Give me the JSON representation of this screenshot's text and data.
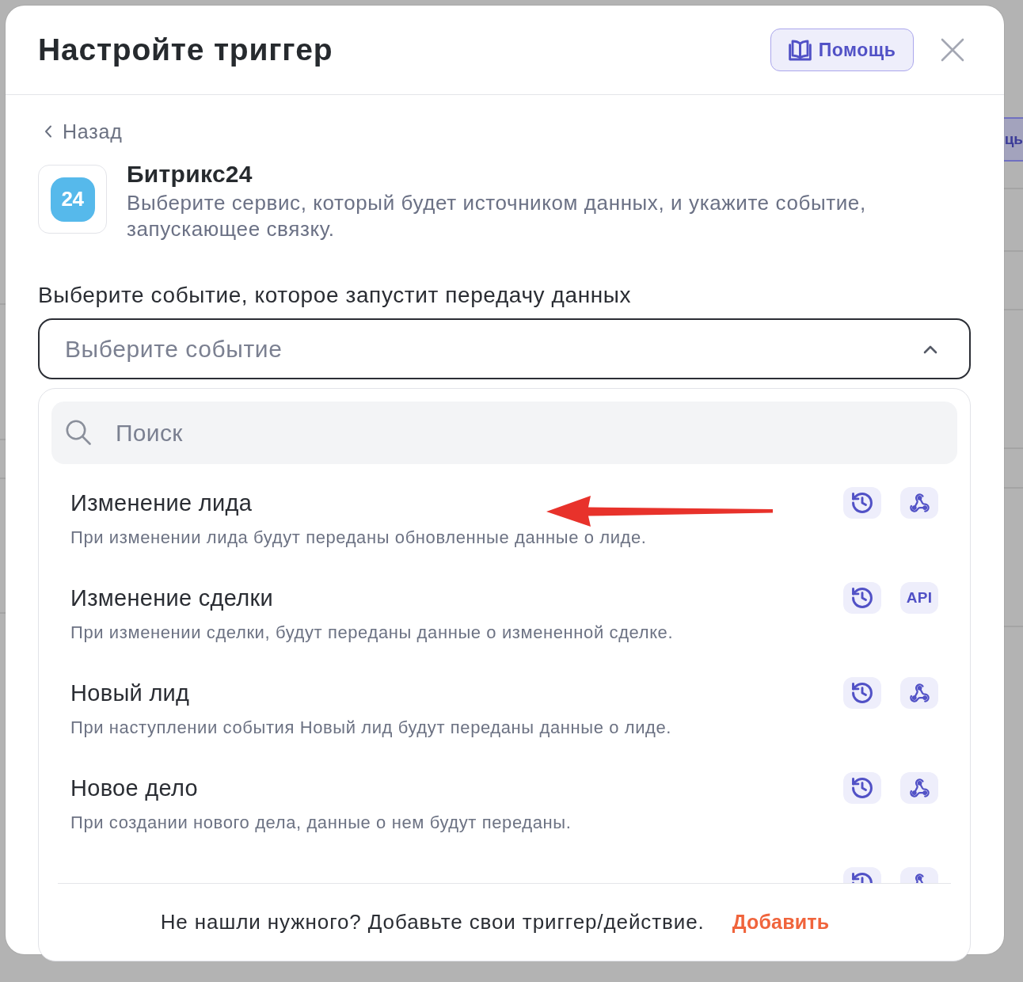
{
  "backdrop": {
    "button_fragment": "ць"
  },
  "dialog": {
    "title": "Настройте триггер",
    "help_button": "Помощь"
  },
  "back_link": "Назад",
  "service": {
    "logo_text": "24",
    "name": "Битрикс24",
    "description": "Выберите сервис, который будет источником данных, и укажите событие, запускающее связку."
  },
  "event_select": {
    "label": "Выберите событие, которое запустит передачу данных",
    "placeholder": "Выберите событие",
    "expanded": true
  },
  "dropdown": {
    "search": {
      "placeholder": "Поиск"
    },
    "events": [
      {
        "title": "Изменение лида",
        "description": "При изменении лида будут переданы обновленные данные о лиде.",
        "selected": false,
        "badges": [
          {
            "kind": "history"
          },
          {
            "kind": "webhook"
          }
        ]
      },
      {
        "title": "Изменение сделки",
        "description": "При изменении сделки, будут переданы данные о измененной сделке.",
        "selected": false,
        "badges": [
          {
            "kind": "history"
          },
          {
            "kind": "api",
            "label": "API"
          }
        ]
      },
      {
        "title": "Новый лид",
        "description": "При наступлении события Новый лид будут переданы данные о лиде.",
        "selected": false,
        "badges": [
          {
            "kind": "history"
          },
          {
            "kind": "webhook"
          }
        ]
      },
      {
        "title": "Новое дело",
        "description": "При создании нового дела, данные о нем будут переданы.",
        "selected": false,
        "badges": [
          {
            "kind": "history"
          },
          {
            "kind": "webhook"
          }
        ]
      },
      {
        "selected": false,
        "badges": [
          {
            "kind": "history"
          },
          {
            "kind": "webhook"
          }
        ]
      }
    ],
    "annotation": {
      "kind": "arrow"
    },
    "footer": {
      "text": "Не нашли нужного? Добавьте свои триггер/действие.",
      "link": "Добавить"
    }
  }
}
